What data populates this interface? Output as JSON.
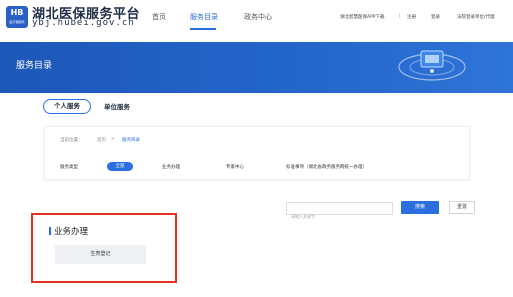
{
  "brand": {
    "badge_text": "HB",
    "badge_sub": "医疗保障局",
    "title": "湖北医保服务平台",
    "url": "ybj.hubei.gov.cn"
  },
  "nav": {
    "items": [
      "首页",
      "服务目录",
      "政务中心"
    ],
    "active_index": 1
  },
  "utility": {
    "download": "湖北智慧医保APP下载",
    "separator": "|",
    "register": "注册",
    "login": "登录",
    "legal_login": "法院登录单位/代理"
  },
  "banner": {
    "title": "服务目录"
  },
  "tabs": {
    "personal": "个人服务",
    "unit": "单位服务",
    "active": "personal"
  },
  "filter": {
    "location_label": "当前位置：",
    "crumb_home": "首页",
    "crumb_sep": ">",
    "crumb_current": "服务目录",
    "type_label": "服务类型",
    "options": [
      "全部",
      "业务办理",
      "专家中心",
      "标准事项（湖北省政务服务网统一办理）"
    ],
    "active_option": 0
  },
  "search": {
    "placeholder": "请输入关键字",
    "button": "搜索",
    "reset": "重置"
  },
  "section": {
    "title": "业务办理",
    "items": [
      "生育登记"
    ]
  },
  "colors": {
    "primary": "#2a6fe0",
    "banner": "#1f5fc4",
    "highlight_frame": "#e3321e"
  }
}
